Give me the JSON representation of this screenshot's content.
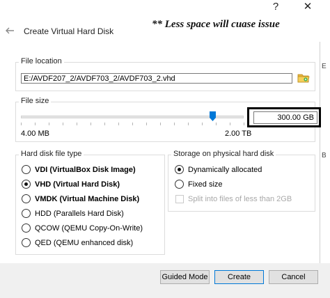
{
  "titlebar": {
    "help": "?",
    "close": "✕"
  },
  "dialog": {
    "title": "Create Virtual Hard Disk"
  },
  "annotation": {
    "note": "** Less space will cuase issue"
  },
  "file_location": {
    "label": "File location",
    "path": "E:/AVDF207_2/AVDF703_2/AVDF703_2.vhd"
  },
  "file_size": {
    "label": "File size",
    "min_label": "4.00 MB",
    "max_label": "2.00 TB",
    "value": "300.00 GB",
    "slider_fraction": 0.86
  },
  "disk_type": {
    "label": "Hard disk file type",
    "options": [
      {
        "label": "VDI (VirtualBox Disk Image)",
        "checked": false,
        "bold": true
      },
      {
        "label": "VHD (Virtual Hard Disk)",
        "checked": true,
        "bold": true
      },
      {
        "label": "VMDK (Virtual Machine Disk)",
        "checked": false,
        "bold": true
      },
      {
        "label": "HDD (Parallels Hard Disk)",
        "checked": false,
        "bold": false
      },
      {
        "label": "QCOW (QEMU Copy-On-Write)",
        "checked": false,
        "bold": false
      },
      {
        "label": "QED (QEMU enhanced disk)",
        "checked": false,
        "bold": false
      }
    ]
  },
  "storage": {
    "label": "Storage on physical hard disk",
    "options": [
      {
        "label": "Dynamically allocated",
        "checked": true
      },
      {
        "label": "Fixed size",
        "checked": false
      }
    ],
    "split_label": "Split into files of less than 2GB"
  },
  "buttons": {
    "guided": "Guided Mode",
    "create": "Create",
    "cancel": "Cancel"
  },
  "side_glyphs": {
    "top": "E",
    "mid": "B"
  },
  "colors": {
    "accent": "#0078d7",
    "highlight_border": "#000000"
  }
}
